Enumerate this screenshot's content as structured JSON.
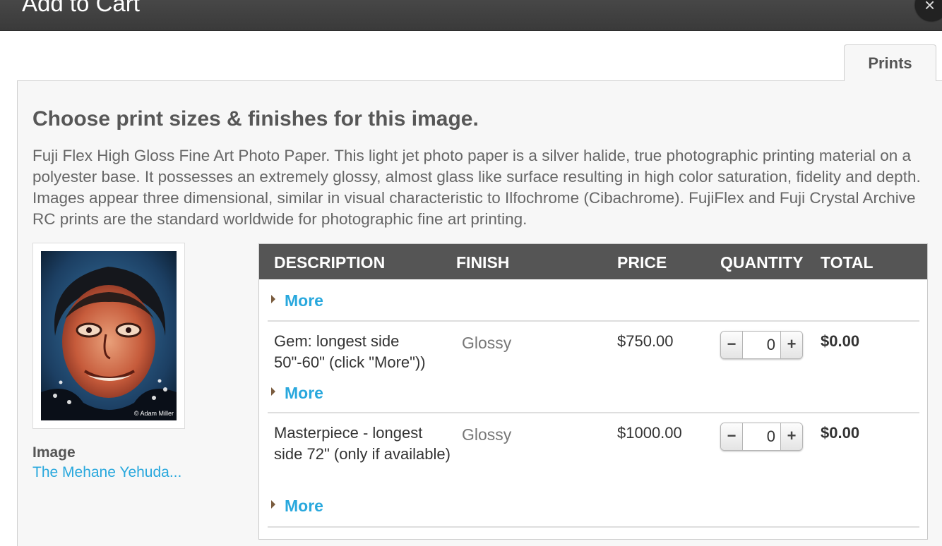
{
  "dialog": {
    "title": "Add to Cart",
    "close_icon": "close-icon"
  },
  "tabs": [
    {
      "label": "Prints",
      "active": true
    }
  ],
  "content": {
    "heading": "Choose print sizes & finishes for this image.",
    "description": "Fuji Flex High Gloss Fine Art Photo Paper. This light jet photo paper is a silver halide, true photographic printing material on a polyester base. It possesses an extremely glossy, almost glass like surface resulting in high color saturation, fidelity and depth. Images appear three dimensional, similar in visual characteristic to Ilfochrome (Cibachrome). FujiFlex and Fuji Crystal Archive RC prints are the standard worldwide for photographic fine art printing."
  },
  "image": {
    "label": "Image",
    "name": "The Mehane Yehuda...",
    "watermark": "© Adam Miller"
  },
  "table": {
    "columns": {
      "description": "DESCRIPTION",
      "finish": "FINISH",
      "price": "PRICE",
      "quantity": "QUANTITY",
      "total": "TOTAL"
    },
    "partial_row": {
      "more_label": "More"
    },
    "rows": [
      {
        "description": "Gem: longest side 50\"-60\" (click \"More\"))",
        "finish": "Glossy",
        "price": "$750.00",
        "quantity": "0",
        "total": "$0.00",
        "more_label": "More"
      },
      {
        "description": "Masterpiece - longest side 72\" (only if available)",
        "finish": "Glossy",
        "price": "$1000.00",
        "quantity": "0",
        "total": "$0.00",
        "more_label": "More"
      }
    ],
    "stepper": {
      "minus": "−",
      "plus": "+"
    }
  },
  "colors": {
    "accent": "#29a8dd",
    "header_bg": "#555555",
    "titlebar_bg": "#404040"
  }
}
